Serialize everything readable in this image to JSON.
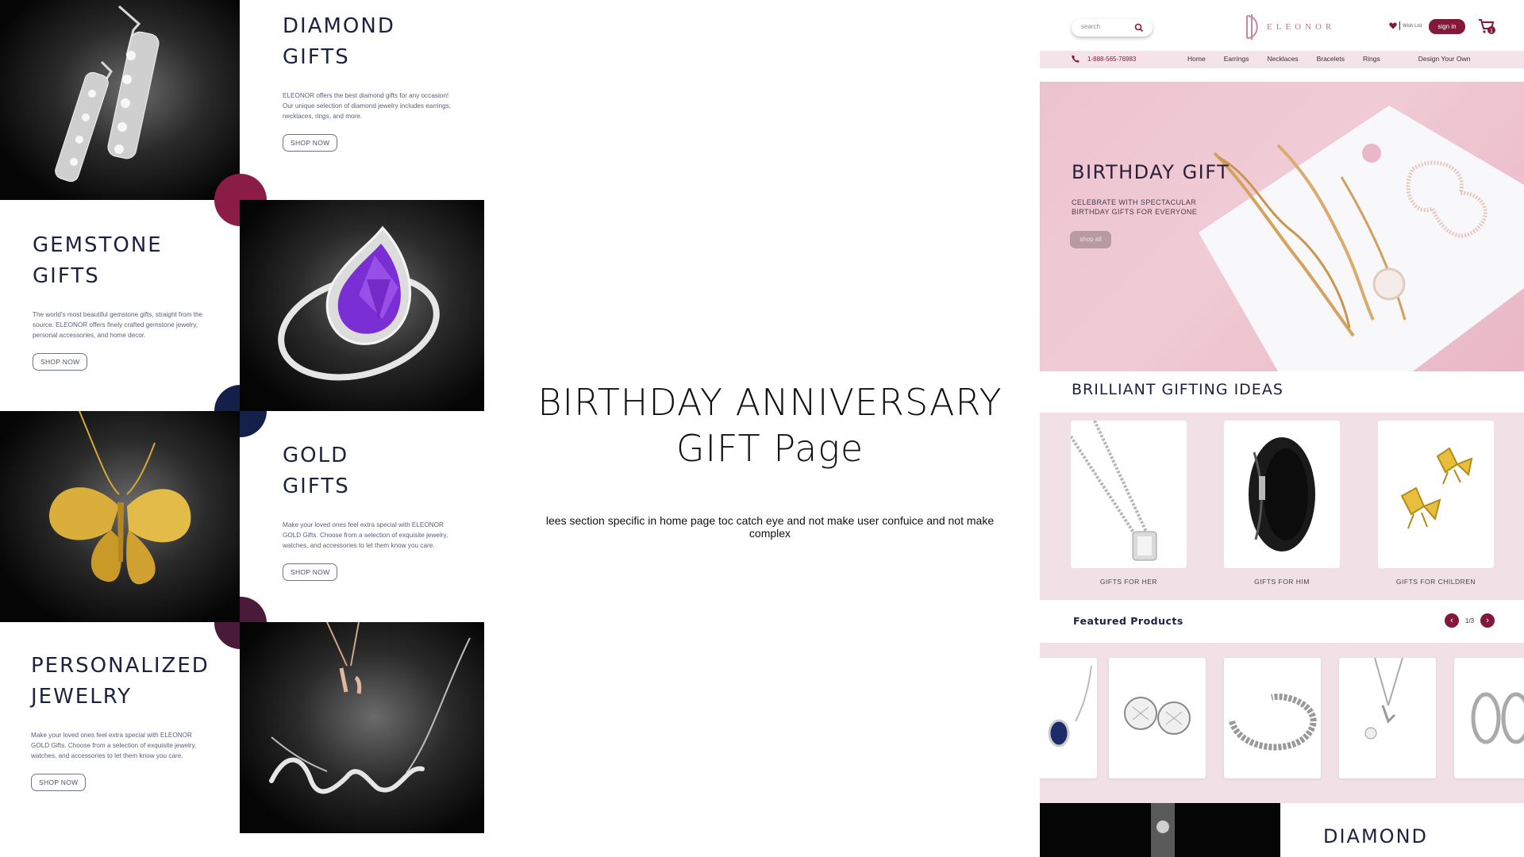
{
  "collage": {
    "diamond": {
      "title_line1": "DIAMOND",
      "title_line2": "GIFTS",
      "desc": "ELEONOR offers the best diamond gifts for any occasion! Our unique selection of diamond jewelry includes earrings, necklaces, rings, and more.",
      "button": "SHOP NOW"
    },
    "gemstone": {
      "title_line1": "GEMSTONE",
      "title_line2": "GIFTS",
      "desc": "The world's most beautiful gemstone gifts, straight from the source. ELEONOR offers finely crafted gemstone jewelry, personal accessories, and home decor.",
      "button": "SHOP NOW"
    },
    "gold": {
      "title_line1": "GOLD",
      "title_line2": "GIFTS",
      "desc": "Make your loved ones feel extra special with ELEONOR GOLD Gifts. Choose from a selection of exquisite jewelry, watches, and accessories to let them know you care.",
      "button": "SHOP NOW"
    },
    "personalized": {
      "title_line1": "PERSONALIZED",
      "title_line2": "JEWELRY",
      "desc": "Make your loved ones feel extra special with ELEONOR GOLD Gifts. Choose from a selection of exquisite jewelry, watches, and accessories to let them know you care.",
      "button": "SHOP NOW"
    },
    "accent_colors": {
      "wine": "#8a1c45",
      "navy": "#14204a",
      "plum": "#4a1a3a"
    }
  },
  "center": {
    "title_line1": "BIRTHDAY ANNIVERSARY",
    "title_line2": "GIFT Page",
    "subtitle": "lees section specific in home page toc catch eye and not make user confuice and not make complex"
  },
  "mockup": {
    "search_placeholder": "search",
    "logo_text": "ELEONOR",
    "wishlist_label": "Wish List",
    "signin_label": "sign in",
    "cart_count": "1",
    "phone": "1-888-565-76983",
    "nav": [
      "Home",
      "Earrings",
      "Necklaces",
      "Bracelets",
      "Rings",
      "Design Your Own"
    ],
    "hero": {
      "title": "BIRTHDAY GIFT",
      "subtitle": "CELEBRATE WITH SPECTACULAR BIRTHDAY GIFTS FOR EVERYONE",
      "button": "shop all"
    },
    "section_title": "BRILLIANT GIFTING IDEAS",
    "gifts": [
      "GIFTS FOR HER",
      "GIFTS FOR HIM",
      "GIFTS FOR CHILDREN"
    ],
    "featured_title": "Featured Products",
    "pager": {
      "prev": "‹",
      "page": "1/3",
      "next": "›"
    },
    "bottom_title": "DIAMOND",
    "brand_color": "#84183a"
  }
}
